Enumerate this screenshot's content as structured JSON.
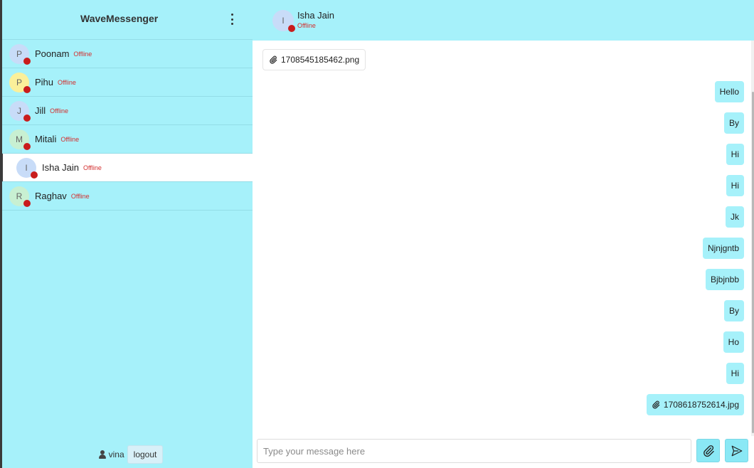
{
  "app": {
    "title": "WaveMessenger"
  },
  "colors": {
    "accent": "#a6f1fa",
    "offline": "#d32f2f",
    "status_dot": "#c91c1c"
  },
  "icons": {
    "menu": "vertical-dots-icon",
    "user": "user-icon",
    "attachment": "paperclip-icon",
    "send": "paper-plane-icon"
  },
  "contacts": [
    {
      "initial": "P",
      "name": "Poonam",
      "status": "Offline",
      "avatar_color": "#c8dcf8"
    },
    {
      "initial": "P",
      "name": "Pihu",
      "status": "Offline",
      "avatar_color": "#fbf09a"
    },
    {
      "initial": "J",
      "name": "Jill",
      "status": "Offline",
      "avatar_color": "#c8dcf8"
    },
    {
      "initial": "M",
      "name": "Mitali",
      "status": "Offline",
      "avatar_color": "#c8f0d2"
    },
    {
      "initial": "I",
      "name": "Isha Jain",
      "status": "Offline",
      "avatar_color": "#c8dcf8",
      "active": true
    },
    {
      "initial": "R",
      "name": "Raghav",
      "status": "Offline",
      "avatar_color": "#c8f0d2"
    }
  ],
  "current_user": {
    "name": "vina",
    "logout_label": "logout"
  },
  "chat": {
    "contact_initial": "I",
    "contact_name": "Isha Jain",
    "contact_status": "Offline",
    "received_file": "1708545185462.png",
    "sent_messages": [
      "Hello",
      "By",
      "Hi",
      "Hi",
      "Jk",
      "Njnjgntb",
      "Bjbjnbb",
      "By",
      "Ho",
      "Hi"
    ],
    "sent_file": "1708618752614.jpg"
  },
  "composer": {
    "placeholder": "Type your message here",
    "value": ""
  }
}
